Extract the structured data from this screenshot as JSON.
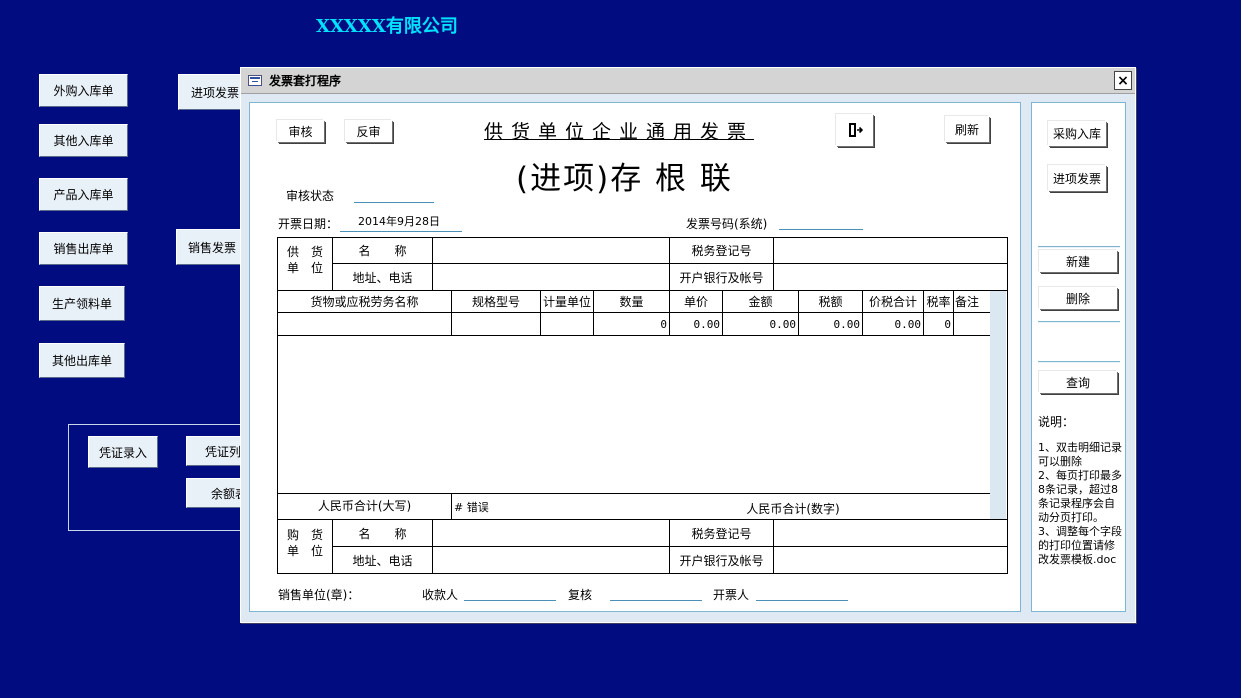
{
  "company": "XXXXX有限公司",
  "background_buttons": {
    "purchase_in": "外购入库单",
    "other_in": "其他入库单",
    "product_in": "产品入库单",
    "sales_out": "销售出库单",
    "production_pick": "生产领料单",
    "other_out": "其他出库单",
    "input_invoice": "进项发票",
    "sales_invoice": "销售发票",
    "voucher_entry": "凭证录入",
    "voucher_list": "凭证列",
    "balance": "余额表"
  },
  "dialog": {
    "title": "发票套打程序",
    "close": "×",
    "toolbar": {
      "audit": "审核",
      "unaudit": "反审",
      "refresh": "刷新"
    },
    "invoice_title": "供货单位企业通用发票",
    "invoice_subtitle": "(进项)存 根 联",
    "audit_status_label": "审核状态",
    "audit_status_value": "",
    "issue_date_label": "开票日期：",
    "issue_date_value": "2014年9月28日",
    "invoice_no_label": "发票号码(系统)",
    "invoice_no_value": "",
    "supplier": {
      "side_label_1": "供　货",
      "side_label_2": "单　位",
      "name_label": "名　　称",
      "address_label": "地址、电话",
      "tax_reg_label": "税务登记号",
      "bank_label": "开户银行及帐号"
    },
    "columns": [
      "货物或应税劳务名称",
      "规格型号",
      "计量单位",
      "数量",
      "单价",
      "金额",
      "税额",
      "价税合计",
      "税率",
      "备注"
    ],
    "rows": [
      {
        "name": "",
        "spec": "",
        "unit": "",
        "qty": "0",
        "price": "0.00",
        "amount": "0.00",
        "tax": "0.00",
        "total": "0.00",
        "rate": "0",
        "remark": ""
      }
    ],
    "rmb_upper_label": "人民币合计(大写)",
    "rmb_upper_value": "# 错误",
    "rmb_num_label": "人民币合计(数字)",
    "buyer": {
      "side_label_1": "购　货",
      "side_label_2": "单　位",
      "name_label": "名　　称",
      "address_label": "地址、电话",
      "tax_reg_label": "税务登记号",
      "bank_label": "开户银行及帐号"
    },
    "seller_seal_label": "销售单位(章)：",
    "payee_label": "收款人",
    "reviewer_label": "复核",
    "drawer_label": "开票人",
    "side": {
      "purchase_in": "采购入库",
      "input_invoice": "进项发票",
      "new": "新建",
      "delete": "删除",
      "query": "查询",
      "note_title": "说明：",
      "note_1": "1、双击明细记录可以删除",
      "note_2": "2、每页打印最多8条记录，超过8条记录程序会自动分页打印。",
      "note_3": "3、调整每个字段的打印位置请修改发票模板.doc"
    }
  }
}
